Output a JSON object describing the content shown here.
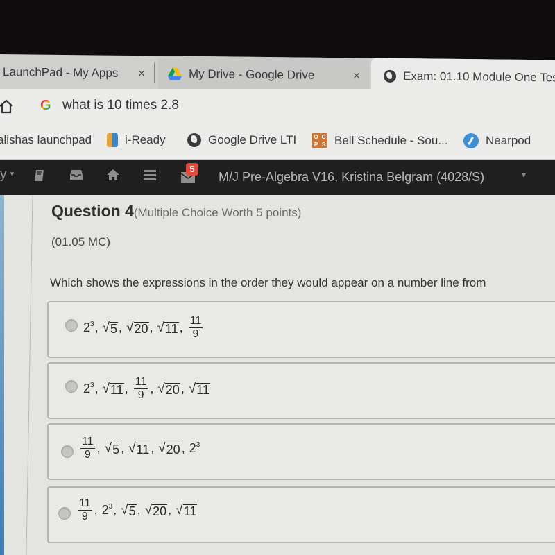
{
  "browser": {
    "tabs": [
      {
        "label": "LaunchPad - My Apps",
        "icon": "launchpad-icon",
        "close": "×"
      },
      {
        "label": "My Drive - Google Drive",
        "icon": "google-drive-icon",
        "close": "×"
      },
      {
        "label": "Exam: 01.10 Module One Tes",
        "icon": "globe-icon",
        "active": true
      }
    ],
    "omnibox": {
      "icon": "google-icon",
      "g": "G",
      "text": "what is 10 times 2.8"
    },
    "bookmarks": [
      {
        "label": "alishas launchpad"
      },
      {
        "label": "i-Ready",
        "icon": "iready-icon"
      },
      {
        "label": "Google Drive LTI",
        "icon": "globe-icon"
      },
      {
        "label": "Bell Schedule - Sou...",
        "icon": "ocps-icon",
        "icon_text": [
          "O",
          "C",
          "P",
          "S"
        ]
      },
      {
        "label": "Nearpod",
        "icon": "nearpod-icon"
      }
    ]
  },
  "app_nav": {
    "partial_menu": "y",
    "caret": "▾",
    "icons": [
      "book-icon",
      "inbox-icon",
      "home-icon",
      "menu-icon",
      "mail-icon"
    ],
    "mail_badge": "5",
    "course_title": "M/J Pre-Algebra V16, Kristina Belgram (4028/S)",
    "course_caret": "▾"
  },
  "question": {
    "title": "Question 4",
    "subtitle": "(Multiple Choice Worth 5 points)",
    "code": "(01.05 MC)",
    "prompt": "Which shows the expressions in the order they would appear on a number line from",
    "choices": [
      {
        "terms": [
          {
            "type": "pow",
            "base": "2",
            "exp": "3"
          },
          {
            "type": "sqrt",
            "arg": "5"
          },
          {
            "type": "sqrt",
            "arg": "20"
          },
          {
            "type": "sqrt",
            "arg": "11"
          },
          {
            "type": "frac",
            "num": "11",
            "den": "9"
          }
        ]
      },
      {
        "terms": [
          {
            "type": "pow",
            "base": "2",
            "exp": "3"
          },
          {
            "type": "sqrt",
            "arg": "11"
          },
          {
            "type": "frac",
            "num": "11",
            "den": "9"
          },
          {
            "type": "sqrt",
            "arg": "20"
          },
          {
            "type": "sqrt",
            "arg": "11"
          }
        ]
      },
      {
        "terms": [
          {
            "type": "frac",
            "num": "11",
            "den": "9"
          },
          {
            "type": "sqrt",
            "arg": "5"
          },
          {
            "type": "sqrt",
            "arg": "11"
          },
          {
            "type": "sqrt",
            "arg": "20"
          },
          {
            "type": "pow",
            "base": "2",
            "exp": "3"
          }
        ]
      },
      {
        "terms": [
          {
            "type": "frac",
            "num": "11",
            "den": "9"
          },
          {
            "type": "pow",
            "base": "2",
            "exp": "3"
          },
          {
            "type": "sqrt",
            "arg": "5"
          },
          {
            "type": "sqrt",
            "arg": "20"
          },
          {
            "type": "sqrt",
            "arg": "11"
          }
        ]
      }
    ],
    "separator": ",",
    "radical": "√"
  }
}
